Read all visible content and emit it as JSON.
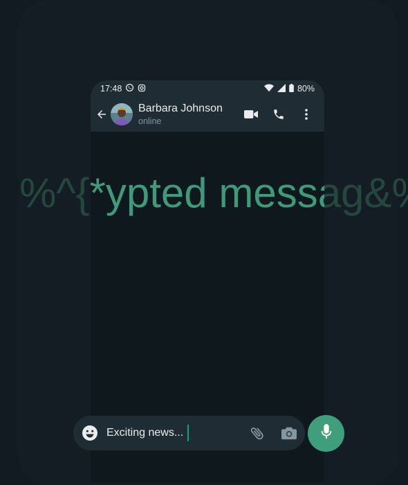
{
  "status_bar": {
    "time": "17:48",
    "battery": "80%"
  },
  "chat": {
    "contact_name": "Barbara Johnson",
    "presence": "online"
  },
  "encrypted_overlay": {
    "text": "%^{*ypted messag&%^",
    "inner_text": "ypted messag"
  },
  "composer": {
    "message_text": "Exciting news..."
  },
  "icons": {
    "status_left": [
      "whatsapp-icon",
      "instagram-icon"
    ],
    "status_right": [
      "wifi-icon",
      "signal-icon",
      "battery-icon"
    ],
    "topbar": [
      "back-arrow-icon",
      "video-call-icon",
      "phone-icon",
      "more-vert-icon"
    ],
    "composer": [
      "emoji-icon",
      "attach-icon",
      "camera-icon",
      "mic-icon"
    ]
  },
  "colors": {
    "app_bar": "#1f2c34",
    "chat_background": "#0f181d",
    "accent": "#3f9f7c",
    "caret": "#00a884",
    "overlay_text": "#3e9a7a"
  }
}
